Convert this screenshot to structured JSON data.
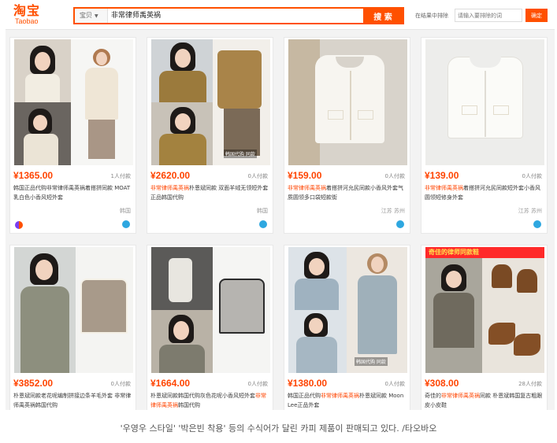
{
  "header": {
    "logo_cn": "淘宝",
    "logo_en": "Taobao",
    "search_scope": "宝贝",
    "search_query": "非常律师禹英祸",
    "search_button": "搜 索",
    "subsearch_label": "在结果中排除",
    "subsearch_placeholder": "请输入要排除的词",
    "subsearch_button": "确定"
  },
  "products": [
    {
      "price": "¥1365.00",
      "sales": "1人付款",
      "title_pre": "韩国正品代购",
      "title_hl": "",
      "title_post": "非常律师禹英祸着搭拼同款 MOAT乳白色小香风短外套",
      "location": "韩国",
      "watermark": ""
    },
    {
      "price": "¥2620.00",
      "sales": "0人付款",
      "title_pre": "",
      "title_hl": "非常律师禹英祸",
      "title_post": "朴恩斌同款 双面羊绒无领短外套 正品韩国代购",
      "location": "韩国",
      "watermark": "韩国代购 同款"
    },
    {
      "price": "¥159.00",
      "sales": "0人付款",
      "title_pre": "",
      "title_hl": "非常律师禹英祸",
      "title_post": "着搭拼河允民同款小香风外套气质圆领多口袋短款街",
      "location": "江苏 苏州",
      "watermark": ""
    },
    {
      "price": "¥139.00",
      "sales": "0人付款",
      "title_pre": "",
      "title_hl": "非常律师禹英祸",
      "title_post": "着搭拼河允民同款短外套小香风圆领短修身外套",
      "location": "江苏 苏州",
      "watermark": ""
    },
    {
      "price": "¥3852.00",
      "sales": "0人付款",
      "title_pre": "",
      "title_hl": "",
      "title_post": "朴恩斌同款老花呢编制拼接边条羊毛外套 非常律师禹英祸韩国代购",
      "location": "",
      "watermark": ""
    },
    {
      "price": "¥1664.00",
      "sales": "0人付款",
      "title_pre": "朴恩斌同款韩国代购灰色花呢小香风短外套",
      "title_hl": "非常律师禹英祸",
      "title_post": "韩国代购",
      "location": "",
      "watermark": ""
    },
    {
      "price": "¥1380.00",
      "sales": "0人付款",
      "title_pre": "韩国正品代购",
      "title_hl": "非常律师禹英祸",
      "title_post": "朴恩斌同款 Moon Lee正品外套",
      "location": "",
      "watermark": "韩国代购 同款"
    },
    {
      "price": "¥308.00",
      "sales": "28人付款",
      "title_pre": "奇佳的",
      "title_hl": "非常律师禹英祸",
      "title_post": "同款 朴恩斌韩国复古粗跟皮小皮鞋",
      "location": "",
      "watermark": ""
    }
  ],
  "product8_banner": "奇佳的律师同款鞋",
  "caption": "'우영우 스타일' '박은빈 착용' 등의 수식어가 달린 카피 제품이 판매되고 있다. /타오바오"
}
